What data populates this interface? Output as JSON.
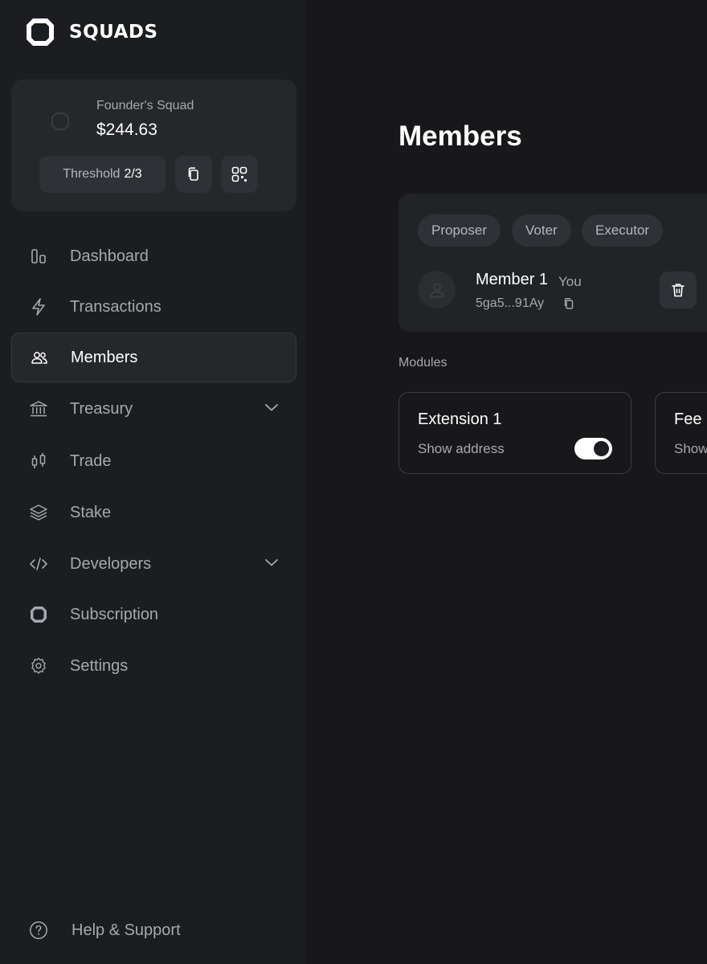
{
  "app": {
    "logo_text": "SQUADS"
  },
  "squad": {
    "name": "Founder's Squad",
    "balance": "$244.63",
    "threshold_label": "Threshold",
    "threshold_value": "2/3"
  },
  "nav": {
    "items": [
      {
        "label": "Dashboard",
        "icon": "dashboard-icon"
      },
      {
        "label": "Transactions",
        "icon": "lightning-icon"
      },
      {
        "label": "Members",
        "icon": "users-icon",
        "active": true
      },
      {
        "label": "Treasury",
        "icon": "bank-icon",
        "expandable": true
      },
      {
        "label": "Trade",
        "icon": "candlestick-icon"
      },
      {
        "label": "Stake",
        "icon": "layers-icon"
      },
      {
        "label": "Developers",
        "icon": "code-icon",
        "expandable": true
      },
      {
        "label": "Subscription",
        "icon": "squads-logo-icon"
      },
      {
        "label": "Settings",
        "icon": "gear-icon"
      }
    ],
    "help_label": "Help & Support"
  },
  "page": {
    "title": "Members"
  },
  "members": {
    "roles": [
      "Proposer",
      "Voter",
      "Executor"
    ],
    "list": [
      {
        "name": "Member 1",
        "tag": "You",
        "address": "5ga5...91Ay"
      }
    ]
  },
  "modules": {
    "label": "Modules",
    "items": [
      {
        "title": "Extension 1",
        "subtitle": "Show address",
        "enabled": true
      },
      {
        "title": "Fee",
        "subtitle": "Show"
      }
    ]
  },
  "colors": {
    "sidebar_bg": "#1c1d21",
    "main_bg": "#18181b",
    "card_bg": "#26272b",
    "muted_text": "#a7a8ae"
  }
}
